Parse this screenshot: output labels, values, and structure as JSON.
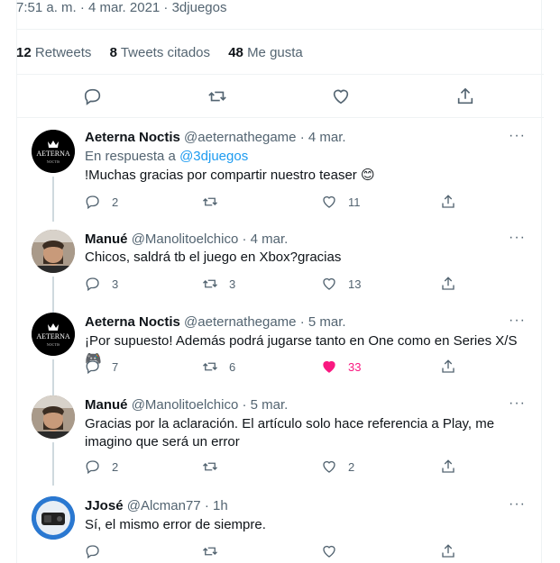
{
  "meta_line": "7:51 a. m. · 4 mar. 2021 · 3djuegos",
  "stats": [
    {
      "count": "12",
      "label": "Retweets"
    },
    {
      "count": "8",
      "label": "Tweets citados"
    },
    {
      "count": "48",
      "label": "Me gusta"
    }
  ],
  "replies": [
    {
      "name": "Aeterna Noctis",
      "handle_time": "@aeternathegame · 4 mar.",
      "replying_prefix": "En respuesta a ",
      "replying_to": "@3djuegos",
      "text": "!Muchas gracias por compartir nuestro teaser 😊",
      "reply_count": "2",
      "retweet_count": "",
      "like_count": "11",
      "liked": false,
      "avatar_text": "AETERNA",
      "avatar_sub": "NOCTIS"
    },
    {
      "name": "Manué",
      "handle_time": "@Manolitoelchico · 4 mar.",
      "text": "Chicos, saldrá tb el juego en Xbox?gracias",
      "reply_count": "3",
      "retweet_count": "3",
      "like_count": "13",
      "liked": false
    },
    {
      "name": "Aeterna Noctis",
      "handle_time": "@aeternathegame · 5 mar.",
      "text": "¡Por supuesto! Además podrá jugarse tanto en One como en Series X/S 🎮",
      "reply_count": "7",
      "retweet_count": "6",
      "like_count": "33",
      "liked": true,
      "avatar_text": "AETERNA",
      "avatar_sub": "NOCTIS"
    },
    {
      "name": "Manué",
      "handle_time": "@Manolitoelchico · 5 mar.",
      "text": "Gracias por la aclaración. El artículo solo hace referencia a Play, me imagino que será un error",
      "reply_count": "2",
      "retweet_count": "",
      "like_count": "2",
      "liked": false
    },
    {
      "name": "JJosé",
      "handle_time": "@Alcman77 · 1h",
      "text": "Sí, el mismo error de siempre.",
      "reply_count": "",
      "retweet_count": "",
      "like_count": "",
      "liked": false
    }
  ],
  "more_label": "···",
  "colors": {
    "like_active": "#f91880",
    "link": "#1d9bf0",
    "muted": "#536471"
  }
}
